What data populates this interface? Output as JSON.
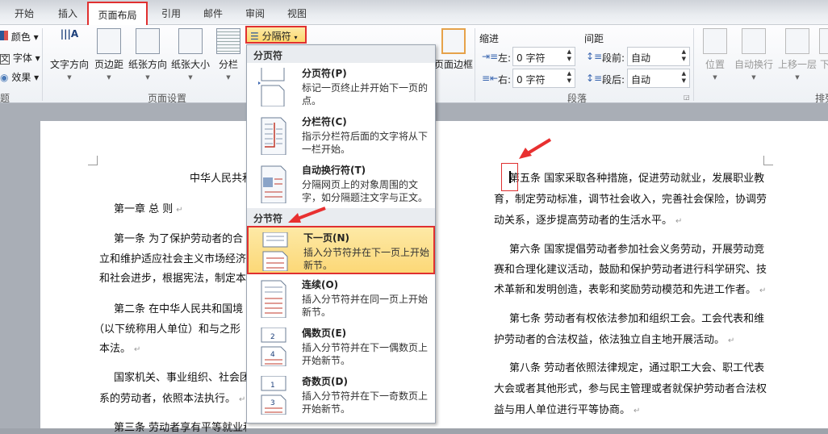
{
  "tabs": [
    "开始",
    "插入",
    "页面布局",
    "引用",
    "邮件",
    "审阅",
    "视图"
  ],
  "ribbon": {
    "theme_items": [
      "颜色",
      "字体",
      "效果"
    ],
    "theme_group": "题",
    "page_setup": {
      "buttons": [
        "文字方向",
        "页边距",
        "纸张方向",
        "纸张大小",
        "分栏"
      ],
      "breaks": "分隔符",
      "group": "页面设置"
    },
    "page_border": "页面边框",
    "paragraph": {
      "indent": "缩进",
      "left_label": "左:",
      "left_value": "0 字符",
      "right_label": "右:",
      "right_value": "0 字符",
      "spacing": "间距",
      "before_label": "段前:",
      "before_value": "自动",
      "after_label": "段后:",
      "after_value": "自动",
      "group": "段落"
    },
    "arrange": {
      "buttons": [
        "位置",
        "自动换行",
        "上移一层",
        "下"
      ],
      "group": "排列"
    }
  },
  "menu": {
    "page_breaks_header": "分页符",
    "section_breaks_header": "分节符",
    "items": [
      {
        "title": "分页符(P)",
        "desc": "标记一页终止并开始下一页的点。"
      },
      {
        "title": "分栏符(C)",
        "desc": "指示分栏符后面的文字将从下一栏开始。"
      },
      {
        "title": "自动换行符(T)",
        "desc": "分隔网页上的对象周围的文字，如分隔题注文字与正文。"
      },
      {
        "title": "下一页(N)",
        "desc": "插入分节符并在下一页上开始新节。"
      },
      {
        "title": "连续(O)",
        "desc": "插入分节符并在同一页上开始新节。"
      },
      {
        "title": "偶数页(E)",
        "desc": "插入分节符并在下一偶数页上开始新节。"
      },
      {
        "title": "奇数页(D)",
        "desc": "插入分节符并在下一奇数页上开始新节。"
      }
    ]
  },
  "left_page": [
    "中华人民共和",
    "第一章 总 则",
    "第一条  为了保护劳动者的合",
    "立和维护适应社会主义市场经济",
    "和社会进步，根据宪法，制定本",
    "第二条  在中华人民共和国境",
    "（以下统称用人单位）和与之形",
    "本法。",
    "国家机关、事业组织、社会团",
    "系的劳动者，依照本法执行。",
    "第三条  劳动者享有平等就业和选择职业的权利、取得劳"
  ],
  "right_page": [
    "第五条  国家采取各种措施，促进劳动就业，发展职业教",
    "育，制定劳动标准，调节社会收入，完善社会保险，协调劳",
    "动关系，逐步提高劳动者的生活水平。",
    "第六条  国家提倡劳动者参加社会义务劳动，开展劳动竞",
    "赛和合理化建议活动，鼓励和保护劳动者进行科学研究、技",
    "术革新和发明创造，表彰和奖励劳动模范和先进工作者。",
    "第七条  劳动者有权依法参加和组织工会。工会代表和维",
    "护劳动者的合法权益，依法独立自主地开展活动。",
    "第八条  劳动者依照法律规定，通过职工大会、职工代表",
    "大会或者其他形式，参与民主管理或者就保护劳动者合法权",
    "益与用人单位进行平等协商。"
  ],
  "colors": {
    "highlight_border": "#e03030",
    "selected_item": "#fcd877"
  }
}
